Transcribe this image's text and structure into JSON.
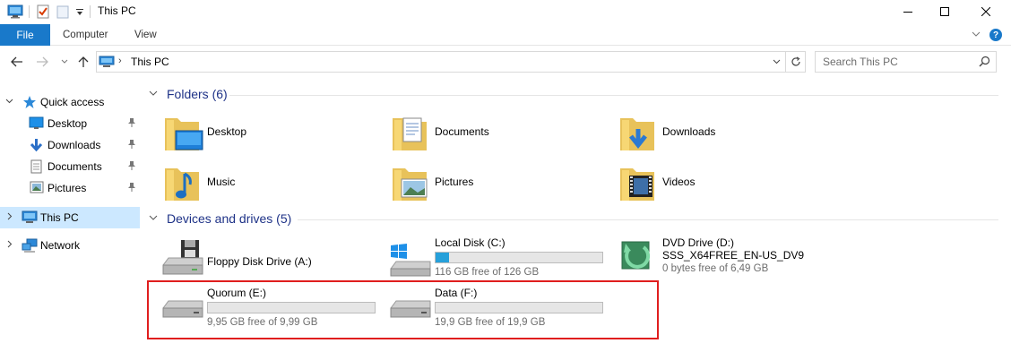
{
  "window": {
    "title": "This PC",
    "minimize_symbol": "—",
    "maximize_symbol": "☐",
    "close_symbol": "✕"
  },
  "ribbon": {
    "tabs": [
      {
        "label": "File"
      },
      {
        "label": "Computer"
      },
      {
        "label": "View"
      }
    ],
    "help_label": "?"
  },
  "address_bar": {
    "location": "This PC",
    "search_placeholder": "Search This PC"
  },
  "nav_pane": {
    "items": [
      {
        "label": "Quick access",
        "icon": "star-icon"
      },
      {
        "label": "Desktop",
        "icon": "desktop-icon",
        "pinned": true
      },
      {
        "label": "Downloads",
        "icon": "download-icon",
        "pinned": true
      },
      {
        "label": "Documents",
        "icon": "document-icon",
        "pinned": true
      },
      {
        "label": "Pictures",
        "icon": "picture-icon",
        "pinned": true
      },
      {
        "label": "This PC",
        "icon": "computer-icon",
        "selected": true
      },
      {
        "label": "Network",
        "icon": "network-icon"
      }
    ]
  },
  "folders": {
    "header": "Folders (6)",
    "items": [
      {
        "label": "Desktop",
        "icon": "desktop-folder-icon"
      },
      {
        "label": "Documents",
        "icon": "documents-folder-icon"
      },
      {
        "label": "Downloads",
        "icon": "downloads-folder-icon"
      },
      {
        "label": "Music",
        "icon": "music-folder-icon"
      },
      {
        "label": "Pictures",
        "icon": "pictures-folder-icon"
      },
      {
        "label": "Videos",
        "icon": "videos-folder-icon"
      }
    ]
  },
  "drives": {
    "header": "Devices and drives (5)",
    "items": [
      {
        "name": "Floppy Disk Drive (A:)",
        "icon": "floppy-drive-icon"
      },
      {
        "name": "Local Disk (C:)",
        "free": "116 GB free of 126 GB",
        "used_fraction": 0.08,
        "icon": "windows-drive-icon"
      },
      {
        "name": "DVD Drive (D:)",
        "volume": "SSS_X64FREE_EN-US_DV9",
        "free": "0 bytes free of 6,49 GB",
        "icon": "dvd-drive-icon"
      },
      {
        "name": "Quorum (E:)",
        "free": "9,95 GB free of 9,99 GB",
        "used_fraction": 0.0,
        "icon": "hard-drive-icon"
      },
      {
        "name": "Data (F:)",
        "free": "19,9 GB free of 19,9 GB",
        "used_fraction": 0.0,
        "icon": "hard-drive-icon"
      }
    ]
  },
  "colors": {
    "accent": "#1979ca",
    "header_text": "#1e3287",
    "selection": "#cce8ff",
    "highlight_border": "#e01e1e",
    "bar_fill": "#26a0da"
  }
}
